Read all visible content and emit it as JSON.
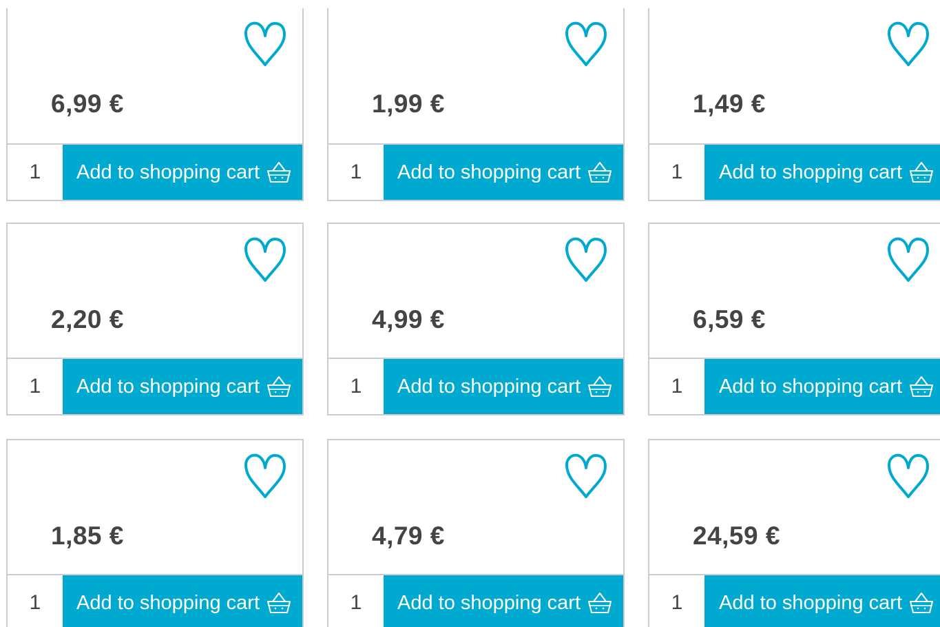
{
  "colors": {
    "accent": "#00a9cf",
    "price_text": "#444444",
    "border": "#c9cdd1",
    "button_text": "#ffffff"
  },
  "icons": {
    "favorite": "heart-outline-icon",
    "cart": "shopping-basket-icon"
  },
  "products": [
    {
      "price": "6,99 €",
      "quantity": "1",
      "cart_label": "Add to shopping cart"
    },
    {
      "price": "1,99 €",
      "quantity": "1",
      "cart_label": "Add to shopping cart"
    },
    {
      "price": "1,49 €",
      "quantity": "1",
      "cart_label": "Add to shopping cart"
    },
    {
      "price": "2,20 €",
      "quantity": "1",
      "cart_label": "Add to shopping cart"
    },
    {
      "price": "4,99 €",
      "quantity": "1",
      "cart_label": "Add to shopping cart"
    },
    {
      "price": "6,59 €",
      "quantity": "1",
      "cart_label": "Add to shopping cart"
    },
    {
      "price": "1,85 €",
      "quantity": "1",
      "cart_label": "Add to shopping cart"
    },
    {
      "price": "4,79 €",
      "quantity": "1",
      "cart_label": "Add to shopping cart"
    },
    {
      "price": "24,59 €",
      "quantity": "1",
      "cart_label": "Add to shopping cart"
    }
  ]
}
